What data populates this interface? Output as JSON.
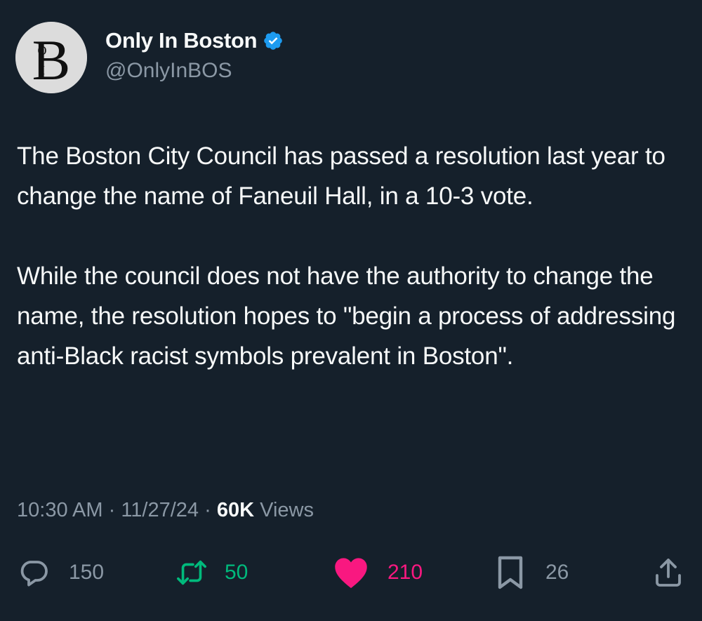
{
  "account": {
    "display_name": "Only In Boston",
    "handle": "@OnlyInBOS",
    "verified": true,
    "avatar_icon": "boi-monogram-logo"
  },
  "tweet": {
    "paragraphs": [
      "The Boston City Council has passed a resolution last year to change the name of Faneuil Hall, in a 10-3 vote.",
      "While the council does not have the authority to change the name, the resolution hopes to \"begin a process of addressing anti-Black racist symbols prevalent in Boston\"."
    ],
    "time": "10:30 AM",
    "date": "11/27/24",
    "separator": "·",
    "views_count": "60K",
    "views_label": "Views"
  },
  "actions": {
    "replies": "150",
    "retweets": "50",
    "likes": "210",
    "bookmarks": "26"
  },
  "colors": {
    "background": "#15202b",
    "text": "#f7f9f9",
    "secondary": "#8b98a5",
    "verified": "#1d9bf0",
    "retweet": "#00ba7c",
    "like": "#f91880"
  }
}
